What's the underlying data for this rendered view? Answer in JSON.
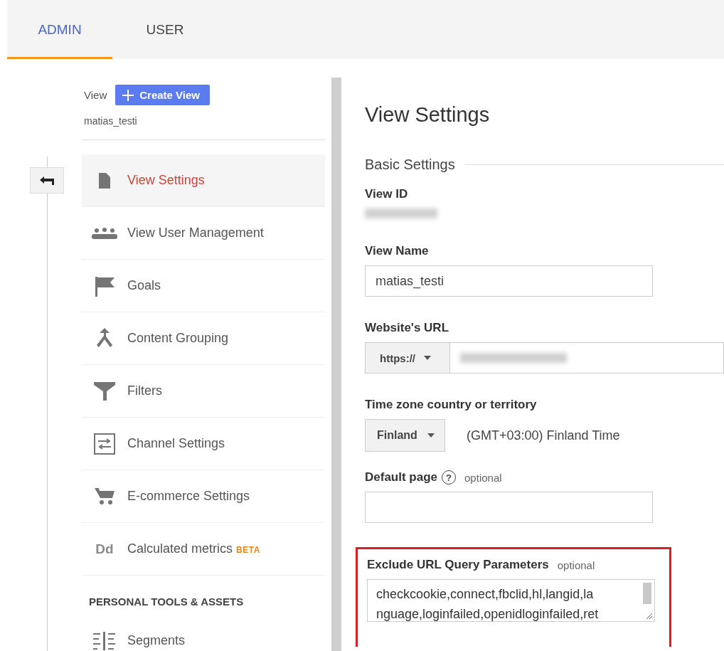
{
  "tabs": [
    {
      "label": "ADMIN",
      "selected": true
    },
    {
      "label": "USER",
      "selected": false
    }
  ],
  "view_selector": {
    "label": "View",
    "create_button": "Create View",
    "current": "matias_testi"
  },
  "menu": [
    {
      "label": "View Settings",
      "selected": true
    },
    {
      "label": "View User Management",
      "selected": false
    },
    {
      "label": "Goals",
      "selected": false
    },
    {
      "label": "Content Grouping",
      "selected": false
    },
    {
      "label": "Filters",
      "selected": false
    },
    {
      "label": "Channel Settings",
      "selected": false
    },
    {
      "label": "E-commerce Settings",
      "selected": false
    },
    {
      "label": "Calculated metrics",
      "icon_text": "Dd",
      "badge": "BETA",
      "selected": false
    }
  ],
  "personal_section": {
    "heading": "PERSONAL TOOLS & ASSETS",
    "items": [
      {
        "label": "Segments",
        "selected": false
      }
    ]
  },
  "settings": {
    "title": "View Settings",
    "section": "Basic Settings",
    "view_id": {
      "label": "View ID"
    },
    "view_name": {
      "label": "View Name",
      "value": "matias_testi"
    },
    "website_url": {
      "label": "Website's URL",
      "protocol": "https://"
    },
    "time_zone": {
      "label": "Time zone country or territory",
      "country": "Finland",
      "zone": "(GMT+03:00) Finland Time"
    },
    "default_page": {
      "label": "Default page",
      "help": "?",
      "note": "optional"
    },
    "exclude_params": {
      "label": "Exclude URL Query Parameters",
      "note": "optional",
      "highlighted": true,
      "lines": [
        "checkcookie,connect,fbclid,hl,langid,la",
        "nguage,loginfailed,openidloginfailed,ret"
      ]
    }
  }
}
